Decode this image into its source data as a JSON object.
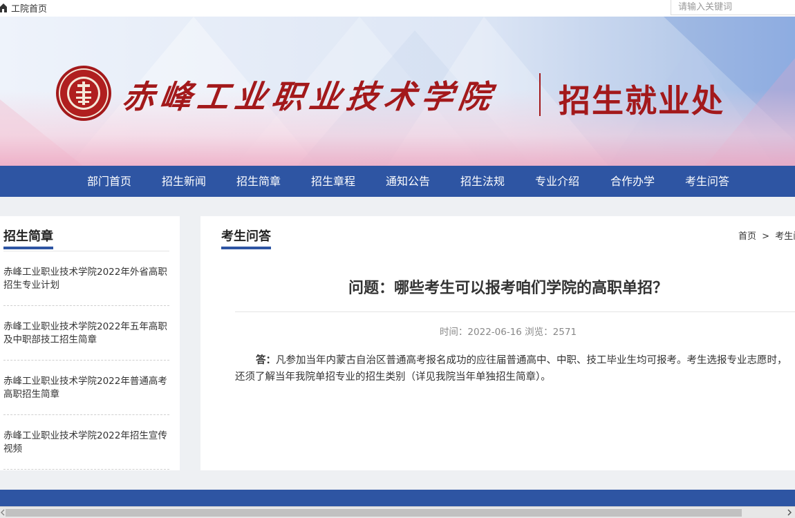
{
  "topbar": {
    "home_label": "工院首页",
    "search_placeholder": "请输入关键词"
  },
  "banner": {
    "college_name": "赤峰工业职业技术学院",
    "department": "招生就业处",
    "brand_color": "#a3191b"
  },
  "nav": {
    "items": [
      "部门首页",
      "招生新闻",
      "招生简章",
      "招生章程",
      "通知公告",
      "招生法规",
      "专业介绍",
      "合作办学",
      "考生问答"
    ],
    "color": "#2e55a3"
  },
  "sidebar": {
    "title": "招生简章",
    "items": [
      "赤峰工业职业技术学院2022年外省高职招生专业计划",
      "赤峰工业职业技术学院2022年五年高职及中职部技工招生简章",
      "赤峰工业职业技术学院2022年普通高考高职招生简章",
      "赤峰工业职业技术学院2022年招生宣传视频"
    ]
  },
  "main": {
    "section_title": "考生问答",
    "breadcrumb": {
      "home": "首页",
      "separator": ">",
      "current": "考生问答"
    },
    "question": "问题：哪些考生可以报考咱们学院的高职单招？",
    "meta": "时间：2022-06-16 浏览：2571",
    "answer_label": "答：",
    "answer_text": "凡参加当年内蒙古自治区普通高考报名成功的应往届普通高中、中职、技工毕业生均可报考。考生选报专业志愿时，还须了解当年我院单招专业的招生类别（详见我院当年单独招生简章）。"
  },
  "icons": {
    "home": "home-icon"
  }
}
